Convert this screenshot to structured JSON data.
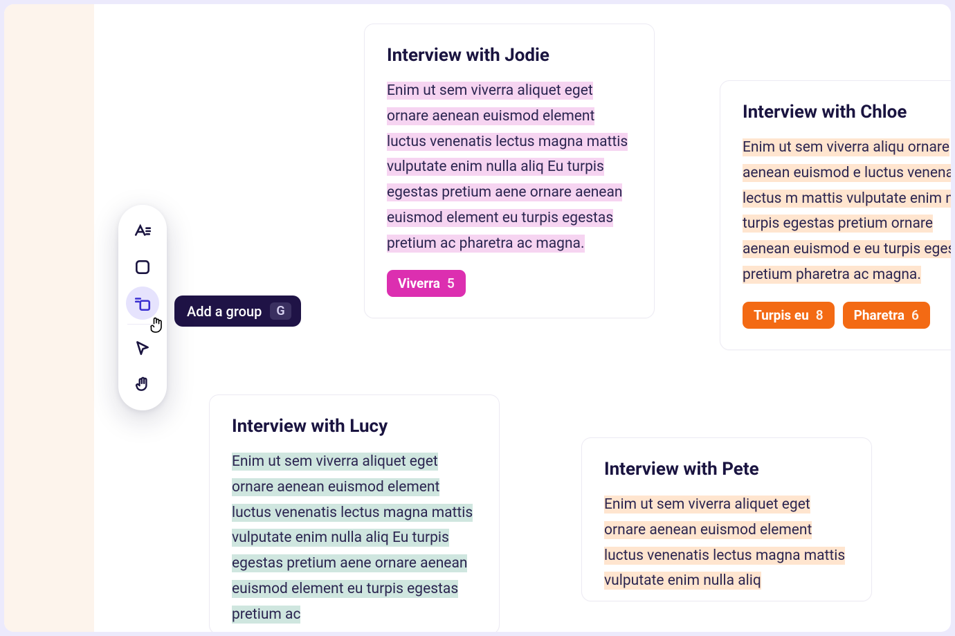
{
  "tooltip": {
    "label": "Add a group",
    "shortcut": "G"
  },
  "toolbar": {
    "text_tool": "text-tool",
    "shape_tool": "shape-tool",
    "group_tool": "group-tool",
    "pointer_tool": "pointer-tool",
    "hand_tool": "hand-tool"
  },
  "cards": {
    "jodie": {
      "title": "Interview with Jodie",
      "body": "Enim ut sem viverra aliquet eget ornare aenean euismod element luctus venenatis lectus magna mattis vulputate enim nulla aliq Eu turpis egestas pretium aene ornare aenean euismod element eu turpis egestas pretium ac pharetra ac magna.",
      "tags": [
        {
          "label": "Viverra",
          "count": "5",
          "color": "magenta"
        }
      ],
      "highlight": "pink"
    },
    "chloe": {
      "title": "Interview with Chloe",
      "body": "Enim ut sem viverra aliqu ornare aenean euismod e luctus venenatis lectus m mattis vulputate enim nu Eu turpis egestas pretium ornare aenean euismod e eu turpis egestas pretium pharetra ac magna.",
      "tags": [
        {
          "label": "Turpis eu",
          "count": "8",
          "color": "orange"
        },
        {
          "label": "Pharetra",
          "count": "6",
          "color": "orange"
        }
      ],
      "highlight": "orange"
    },
    "lucy": {
      "title": "Interview with Lucy",
      "body": "Enim ut sem viverra aliquet eget ornare aenean euismod element luctus venenatis lectus magna mattis vulputate enim nulla aliq Eu turpis egestas pretium aene ornare aenean euismod element eu turpis egestas pretium ac",
      "highlight": "teal"
    },
    "pete": {
      "title": "Interview with Pete",
      "body": "Enim ut sem viverra aliquet eget ornare aenean euismod element luctus venenatis lectus magna mattis vulputate enim nulla aliq",
      "highlight": "orange"
    }
  }
}
